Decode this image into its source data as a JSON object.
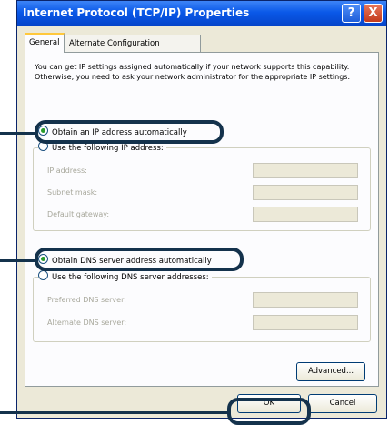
{
  "window": {
    "title": "Internet Protocol (TCP/IP) Properties",
    "help_label": "?",
    "close_label": "X"
  },
  "tabs": [
    {
      "label": "General",
      "active": true
    },
    {
      "label": "Alternate Configuration",
      "active": false
    }
  ],
  "description": "You can get IP settings assigned automatically if your network supports this capability. Otherwise, you need to ask your network administrator for the appropriate IP settings.",
  "ip": {
    "auto_label": "Obtain an IP address automatically",
    "manual_label": "Use the following IP address:",
    "selected": "auto",
    "fields": [
      {
        "label": "IP address:",
        "value": ""
      },
      {
        "label": "Subnet mask:",
        "value": ""
      },
      {
        "label": "Default gateway:",
        "value": ""
      }
    ]
  },
  "dns": {
    "auto_label": "Obtain DNS server address automatically",
    "manual_label": "Use the following DNS server addresses:",
    "selected": "auto",
    "fields": [
      {
        "label": "Preferred DNS server:",
        "value": ""
      },
      {
        "label": "Alternate DNS server:",
        "value": ""
      }
    ]
  },
  "buttons": {
    "advanced": "Advanced...",
    "ok": "OK",
    "cancel": "Cancel"
  },
  "colors": {
    "titlebar": "#0a58e8",
    "callout": "#14324c",
    "dialog_bg": "#ece9d8"
  }
}
